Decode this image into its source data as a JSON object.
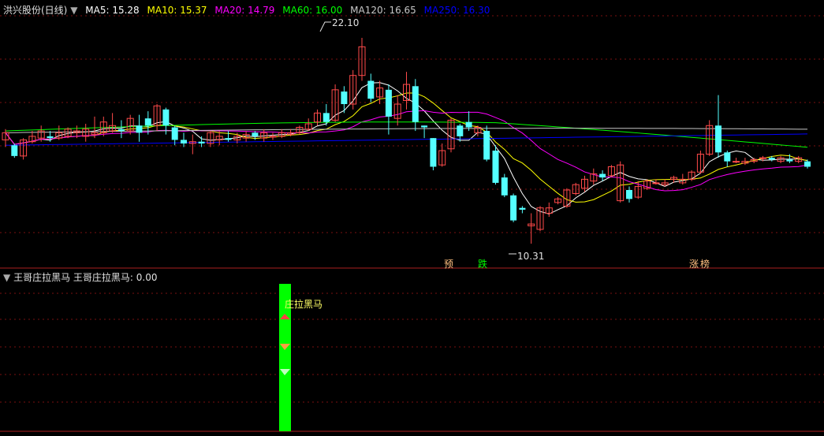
{
  "header": {
    "title": "洪兴股份(日线)",
    "ma": [
      {
        "label": "MA5: 15.28",
        "color": "#ffffff"
      },
      {
        "label": "MA10: 15.37",
        "color": "#ffff00"
      },
      {
        "label": "MA20: 14.79",
        "color": "#ff00ff"
      },
      {
        "label": "MA60: 16.00",
        "color": "#00ff00"
      },
      {
        "label": "MA120: 16.65",
        "color": "#c8c8c8"
      },
      {
        "label": "MA250: 16.30",
        "color": "#0000ff"
      }
    ]
  },
  "subpanel": {
    "title": "王哥庄拉黑马",
    "value_label": "王哥庄拉黑马: 0.00",
    "bar_label": "庄拉黑马"
  },
  "chart_data": {
    "type": "candlestick",
    "price_high_label": "22.10",
    "price_low_label": "10.31",
    "signals": [
      {
        "text": "预",
        "color": "#ffc080"
      },
      {
        "text": "跌",
        "color": "#00ff00"
      },
      {
        "text": "涨",
        "color": "#ffc080"
      },
      {
        "text": "榜",
        "color": "#ffc080"
      }
    ],
    "candles": [
      [
        16.4,
        16.8,
        16.0,
        17.0
      ],
      [
        16.1,
        15.5,
        15.4,
        16.2
      ],
      [
        15.5,
        16.4,
        15.3,
        16.5
      ],
      [
        16.3,
        16.6,
        16.2,
        16.9
      ],
      [
        16.5,
        16.9,
        16.3,
        17.2
      ],
      [
        16.6,
        16.5,
        16.3,
        16.9
      ],
      [
        16.5,
        16.8,
        16.4,
        17.2
      ],
      [
        16.6,
        17.0,
        16.5,
        17.1
      ],
      [
        16.8,
        16.9,
        16.5,
        17.2
      ],
      [
        16.6,
        17.0,
        16.3,
        17.3
      ],
      [
        16.7,
        16.8,
        16.5,
        17.7
      ],
      [
        16.8,
        17.4,
        16.6,
        17.7
      ],
      [
        16.9,
        17.2,
        16.8,
        17.9
      ],
      [
        17.0,
        16.9,
        16.5,
        17.5
      ],
      [
        16.9,
        17.6,
        16.7,
        17.8
      ],
      [
        17.2,
        16.8,
        16.3,
        17.8
      ],
      [
        17.6,
        17.2,
        16.7,
        18.0
      ],
      [
        17.2,
        18.3,
        16.9,
        18.4
      ],
      [
        18.1,
        17.2,
        16.7,
        18.2
      ],
      [
        17.1,
        16.4,
        16.1,
        17.2
      ],
      [
        16.4,
        16.2,
        16.0,
        16.8
      ],
      [
        16.2,
        16.3,
        15.6,
        16.7
      ],
      [
        16.3,
        16.2,
        16.0,
        16.6
      ],
      [
        16.2,
        16.8,
        16.0,
        16.9
      ],
      [
        16.4,
        16.6,
        16.1,
        16.9
      ],
      [
        16.5,
        16.4,
        16.3,
        16.9
      ],
      [
        16.4,
        16.6,
        16.2,
        16.8
      ],
      [
        16.5,
        16.7,
        16.3,
        16.9
      ],
      [
        16.8,
        16.6,
        16.4,
        16.9
      ],
      [
        16.5,
        16.8,
        16.3,
        17.0
      ],
      [
        16.6,
        16.6,
        16.4,
        16.8
      ],
      [
        16.6,
        16.8,
        16.5,
        17.0
      ],
      [
        16.7,
        16.8,
        16.6,
        17.0
      ],
      [
        16.8,
        17.1,
        16.7,
        17.2
      ],
      [
        17.0,
        17.3,
        16.9,
        17.6
      ],
      [
        17.4,
        17.9,
        17.2,
        18.1
      ],
      [
        17.9,
        17.4,
        17.2,
        18.4
      ],
      [
        17.5,
        19.2,
        17.4,
        19.5
      ],
      [
        19.1,
        18.4,
        17.9,
        19.4
      ],
      [
        18.4,
        20.0,
        18.1,
        20.3
      ],
      [
        20.0,
        21.6,
        19.7,
        22.1
      ],
      [
        19.7,
        18.7,
        18.5,
        20.1
      ],
      [
        18.8,
        19.3,
        18.4,
        19.7
      ],
      [
        19.2,
        17.7,
        16.7,
        19.5
      ],
      [
        17.6,
        18.4,
        17.2,
        18.9
      ],
      [
        18.6,
        19.5,
        18.1,
        20.2
      ],
      [
        19.4,
        17.4,
        16.9,
        19.8
      ],
      [
        17.2,
        17.1,
        16.5,
        17.2
      ],
      [
        16.5,
        14.9,
        14.7,
        16.5
      ],
      [
        15.0,
        15.8,
        14.9,
        16.2
      ],
      [
        15.9,
        17.5,
        15.7,
        17.6
      ],
      [
        17.2,
        16.6,
        16.3,
        17.3
      ],
      [
        17.4,
        17.1,
        16.9,
        18.0
      ],
      [
        16.8,
        17.1,
        16.6,
        17.2
      ],
      [
        16.9,
        15.3,
        15.2,
        17.2
      ],
      [
        15.8,
        14.0,
        13.9,
        16.1
      ],
      [
        14.3,
        13.3,
        13.2,
        14.5
      ],
      [
        13.3,
        11.9,
        11.8,
        13.4
      ],
      [
        12.6,
        12.5,
        12.3,
        12.7
      ],
      [
        11.6,
        11.7,
        10.6,
        12.3
      ],
      [
        11.4,
        12.6,
        11.3,
        12.7
      ],
      [
        12.3,
        12.6,
        12.1,
        12.9
      ],
      [
        12.9,
        13.1,
        12.8,
        13.2
      ],
      [
        12.7,
        13.6,
        12.6,
        13.7
      ],
      [
        13.4,
        13.9,
        13.3,
        14.0
      ],
      [
        13.7,
        14.2,
        13.5,
        14.4
      ],
      [
        14.1,
        14.5,
        13.9,
        14.8
      ],
      [
        14.5,
        14.3,
        14.1,
        14.7
      ],
      [
        14.4,
        14.9,
        14.3,
        15.0
      ],
      [
        13.0,
        15.0,
        12.9,
        15.2
      ],
      [
        13.6,
        13.1,
        12.9,
        13.8
      ],
      [
        13.2,
        13.8,
        13.1,
        14.1
      ],
      [
        13.7,
        14.1,
        13.6,
        14.2
      ],
      [
        14.0,
        14.0,
        13.9,
        14.2
      ],
      [
        13.9,
        14.0,
        13.8,
        14.2
      ],
      [
        14.2,
        14.3,
        14.0,
        14.4
      ],
      [
        14.0,
        14.2,
        13.9,
        14.5
      ],
      [
        14.2,
        14.6,
        14.1,
        14.7
      ],
      [
        14.6,
        15.6,
        14.5,
        15.8
      ],
      [
        15.6,
        17.2,
        15.5,
        17.5
      ],
      [
        17.2,
        15.7,
        15.4,
        18.9
      ],
      [
        15.7,
        15.2,
        14.9,
        15.8
      ],
      [
        15.2,
        15.2,
        15.1,
        15.4
      ],
      [
        15.1,
        15.2,
        15.0,
        15.4
      ],
      [
        15.2,
        15.3,
        15.1,
        15.4
      ],
      [
        15.4,
        15.4,
        15.2,
        15.5
      ],
      [
        15.4,
        15.3,
        15.2,
        15.5
      ],
      [
        15.2,
        15.4,
        15.1,
        15.5
      ],
      [
        15.3,
        15.2,
        15.1,
        15.6
      ],
      [
        15.2,
        15.4,
        15.1,
        15.5
      ],
      [
        15.2,
        14.9,
        14.8,
        15.3
      ]
    ]
  }
}
